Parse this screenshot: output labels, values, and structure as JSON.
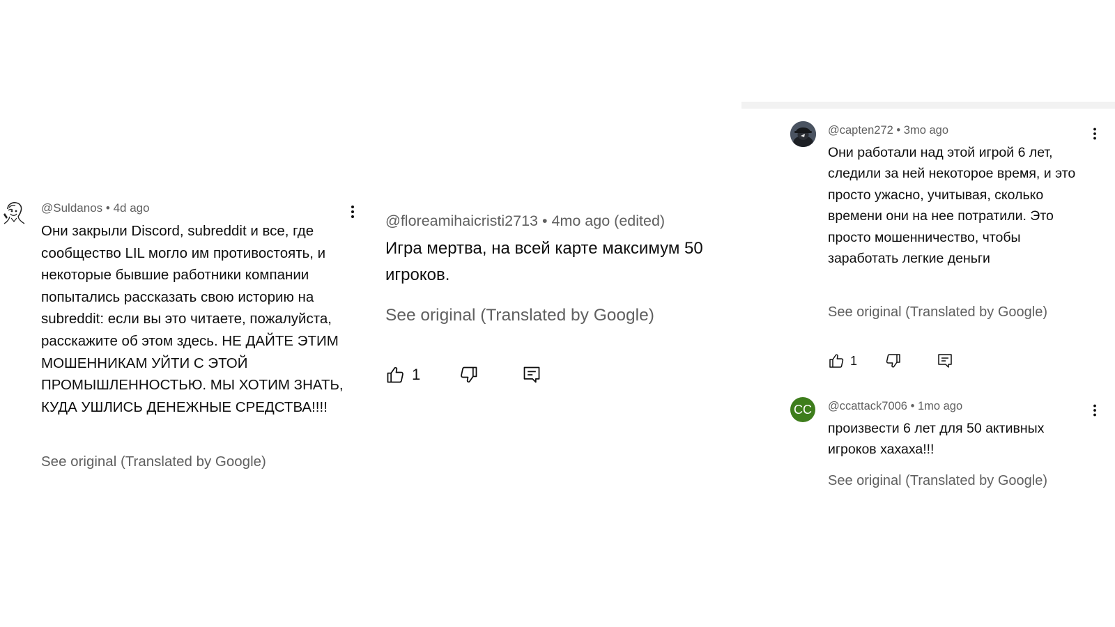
{
  "left_comment": {
    "handle": "@Suldanos",
    "separator": "•",
    "time": "4d ago",
    "text": "Они закрыли Discord, subreddit и все, где сообщество LIL могло им противостоять, и некоторые бывшие работники компании попытались рассказать свою историю на subreddit: если вы это читаете, пожалуйста, расскажите об этом здесь. НЕ ДАЙТЕ ЭТИМ МОШЕННИКАМ УЙТИ С ЭТОЙ ПРОМЫШЛЕННОСТЬЮ. МЫ ХОТИМ ЗНАТЬ, КУДА УШЛИСЬ ДЕНЕЖНЫЕ СРЕДСТВА!!!!",
    "see_original": "See original (Translated by Google)",
    "avatar_icon": "sketch-portrait-avatar"
  },
  "middle_comment": {
    "handle": "@floreamihaicristi2713",
    "separator": "•",
    "time": "4mo ago",
    "edited": "(edited)",
    "text": "Игра мертва, на всей карте максимум 50 игроков.",
    "see_original": "See original (Translated by Google)",
    "like_count": "1"
  },
  "right_comment_1": {
    "handle": "@capten272",
    "separator": "•",
    "time": "3mo ago",
    "text": "Они работали над этой игрой 6 лет, следили за ней некоторое время, и это просто ужасно, учитывая, сколько времени они на нее потратили. Это просто мошенничество, чтобы заработать легкие деньги",
    "see_original": "See original (Translated by Google)",
    "like_count": "1",
    "avatar_icon": "dark-hat-avatar"
  },
  "right_comment_2": {
    "handle": "@ccattack7006",
    "separator": "•",
    "time": "1mo ago",
    "avatar_initials": "CC",
    "avatar_color": "#3e7d1c",
    "text": "произвести 6 лет для 50 активных игроков хахаха!!!",
    "see_original": "See original (Translated by Google)"
  },
  "colors": {
    "meta_text": "#606060",
    "body_text": "#0f0f0f",
    "divider": "#f2f2f2"
  },
  "icons": {
    "like": "thumbs-up-icon",
    "dislike": "thumbs-down-icon",
    "reply": "reply-comment-icon",
    "more": "more-vertical-icon"
  }
}
